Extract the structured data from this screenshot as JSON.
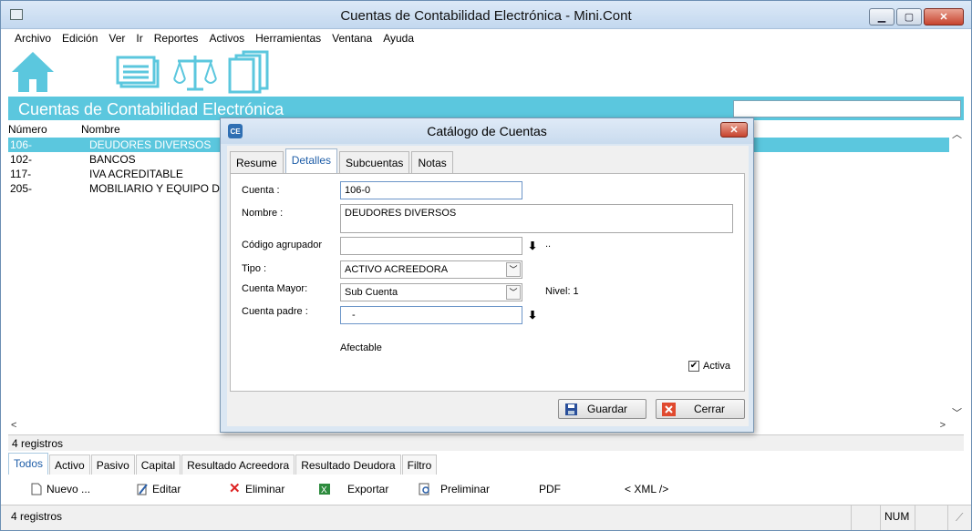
{
  "window": {
    "title": "Cuentas de Contabilidad Electrónica - Mini.Cont"
  },
  "menu": [
    "Archivo",
    "Edición",
    "Ver",
    "Ir",
    "Reportes",
    "Activos",
    "Herramientas",
    "Ventana",
    "Ayuda"
  ],
  "toolbar": {
    "icons": [
      "home-icon",
      "list-window-icon",
      "balance-scale-icon",
      "documents-stack-icon"
    ]
  },
  "header": {
    "title": "Cuentas de Contabilidad Electrónica",
    "search_value": ""
  },
  "grid": {
    "columns": [
      "Número",
      "Nombre"
    ],
    "rows": [
      {
        "numero": "106-",
        "nombre": "DEUDORES DIVERSOS"
      },
      {
        "numero": "102-",
        "nombre": "BANCOS"
      },
      {
        "numero": "117-",
        "nombre": "IVA ACREDITABLE"
      },
      {
        "numero": "205-",
        "nombre": "MOBILIARIO Y EQUIPO DE"
      }
    ],
    "selected_index": 0
  },
  "record_count": "4 registros",
  "filter_tabs": [
    "Todos",
    "Activo",
    "Pasivo",
    "Capital",
    "Resultado Acreedora",
    "Resultado Deudora",
    "Filtro"
  ],
  "actions": {
    "nuevo": "Nuevo ...",
    "editar": "Editar",
    "eliminar": "Eliminar",
    "exportar": "Exportar",
    "preliminar": "Preliminar",
    "pdf": "PDF",
    "xml": "< XML />"
  },
  "statusbar": {
    "left": "4 registros",
    "num": "NUM"
  },
  "dialog": {
    "title": "Catálogo de Cuentas",
    "icon_text": "CE",
    "tabs": [
      "Resume",
      "Detalles",
      "Subcuentas",
      "Notas"
    ],
    "active_tab": "Detalles",
    "fields": {
      "cuenta_label": "Cuenta :",
      "cuenta_value": "106-0",
      "nombre_label": "Nombre :",
      "nombre_value": "DEUDORES DIVERSOS",
      "codigo_label": "Código agrupador",
      "codigo_value": "",
      "codigo_suffix": "..",
      "tipo_label": "Tipo :",
      "tipo_value": "ACTIVO ACREEDORA",
      "mayor_label": "Cuenta Mayor:",
      "mayor_value": "Sub Cuenta",
      "nivel_text": "Nivel: 1",
      "padre_label": "Cuenta padre :",
      "padre_value": "-",
      "afectable_text": "Afectable",
      "activa_label": "Activa",
      "activa_checked": true
    },
    "buttons": {
      "guardar": "Guardar",
      "cerrar": "Cerrar"
    }
  }
}
